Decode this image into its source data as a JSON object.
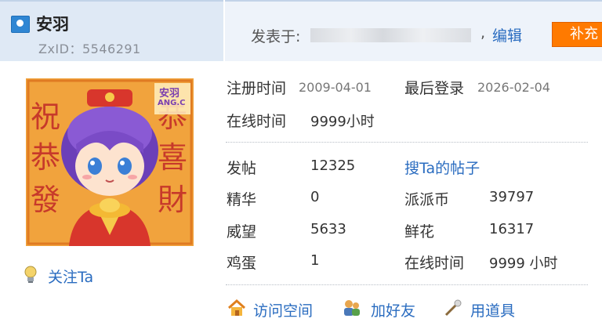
{
  "user": {
    "name": "安羽",
    "zxid": "ZxID：5546291",
    "follow_label": "关注Ta"
  },
  "post_meta": {
    "posted_label": "发表于:",
    "comma": ",",
    "edit_label": "编辑",
    "supplement_label": "补充"
  },
  "avatar": {
    "name_text": "安羽",
    "name_sub": "ANG.C",
    "watermark": [
      "祝",
      "恭",
      "發",
      "恭",
      "喜",
      "財"
    ]
  },
  "profile": {
    "register_label": "注册时间",
    "register_value": "2009-04-01",
    "last_login_label": "最后登录",
    "last_login_value": "2026-02-04",
    "online_label": "在线时间",
    "online_value": "9999小时"
  },
  "stats": {
    "posts_label": "发帖",
    "posts_value": "12325",
    "search_posts_link": "搜Ta的帖子",
    "digest_label": "精华",
    "digest_value": "0",
    "coins_label": "派派币",
    "coins_value": "39797",
    "prestige_label": "威望",
    "prestige_value": "5633",
    "flowers_label": "鲜花",
    "flowers_value": "16317",
    "eggs_label": "鸡蛋",
    "eggs_value": "1",
    "online_label": "在线时间",
    "online_value": "9999 小时"
  },
  "actions": {
    "visit_space": "访问空间",
    "add_friend": "加好友",
    "use_item": "用道具"
  },
  "colors": {
    "link": "#2a6cc0",
    "accent_button": "#ff7a00",
    "header_bg": "#dfe9f5"
  }
}
